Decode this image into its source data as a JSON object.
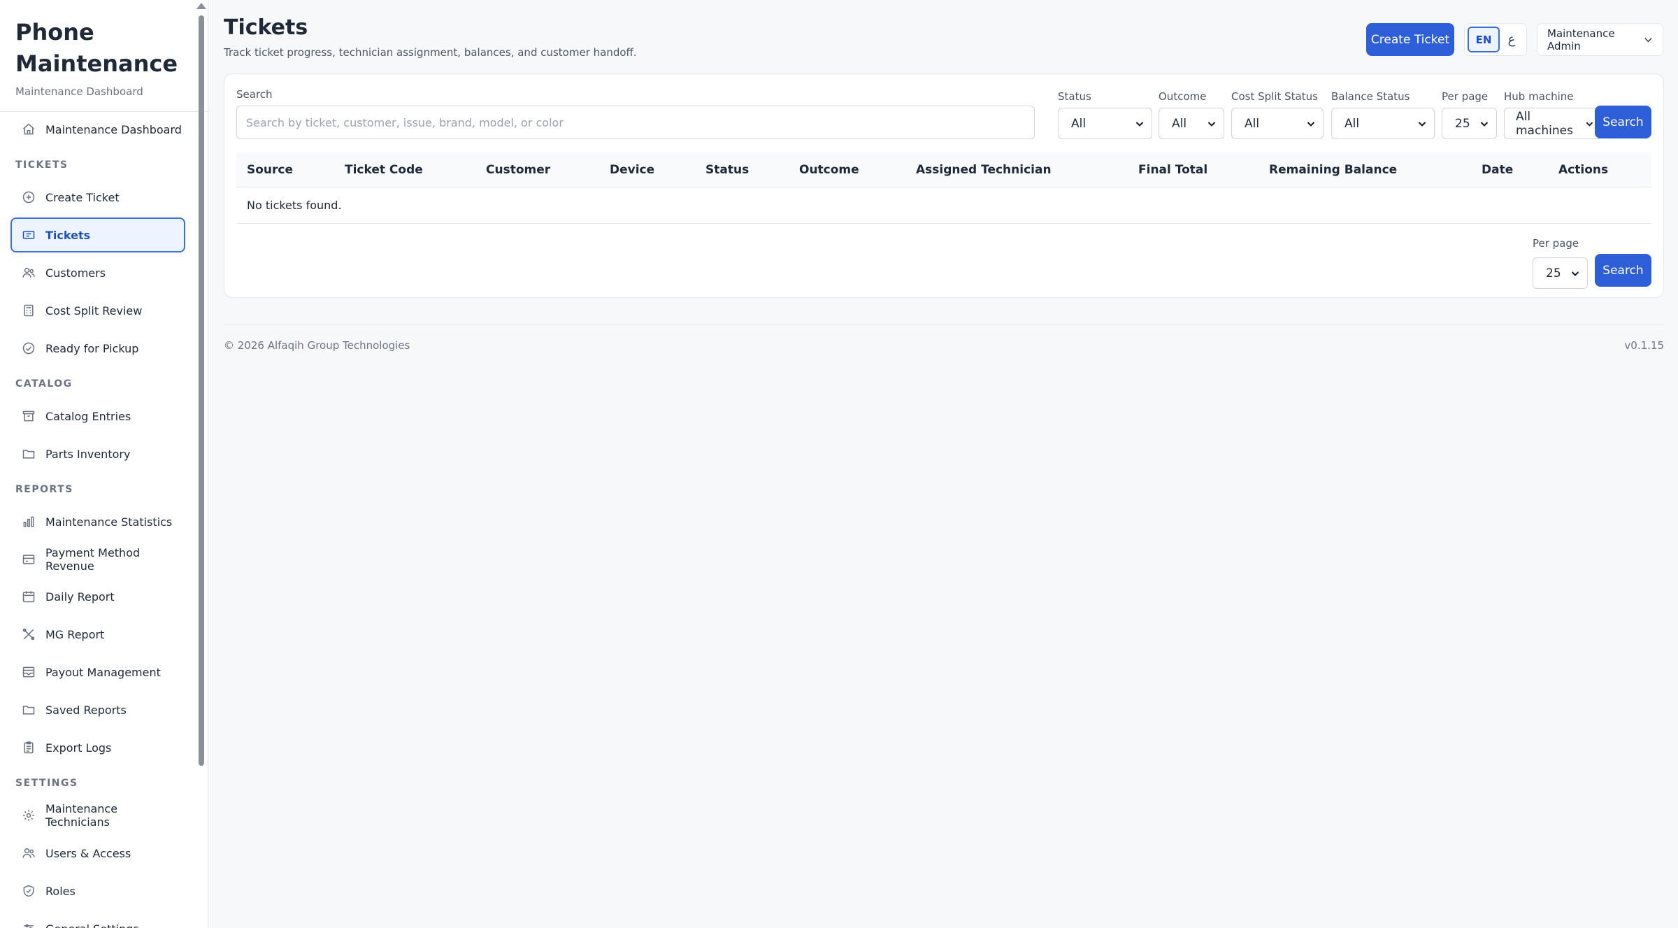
{
  "sidebar": {
    "brand_title": "Phone Maintenance",
    "brand_sub": "Maintenance Dashboard",
    "dashboard": "Maintenance Dashboard",
    "sections": {
      "tickets": "TICKETS",
      "catalog": "CATALOG",
      "reports": "REPORTS",
      "settings": "SETTINGS"
    },
    "items": {
      "create_ticket": "Create Ticket",
      "tickets": "Tickets",
      "customers": "Customers",
      "cost_split_review": "Cost Split Review",
      "ready_for_pickup": "Ready for Pickup",
      "catalog_entries": "Catalog Entries",
      "parts_inventory": "Parts Inventory",
      "maintenance_statistics": "Maintenance Statistics",
      "payment_method_revenue": "Payment Method Revenue",
      "daily_report": "Daily Report",
      "mg_report": "MG Report",
      "payout_management": "Payout Management",
      "saved_reports": "Saved Reports",
      "export_logs": "Export Logs",
      "maintenance_technicians": "Maintenance Technicians",
      "users_access": "Users & Access",
      "roles": "Roles",
      "general_settings": "General Settings"
    }
  },
  "header": {
    "title": "Tickets",
    "subtitle": "Track ticket progress, technician assignment, balances, and customer handoff.",
    "create_button": "Create Ticket",
    "lang_en": "EN",
    "lang_ar": "ع",
    "user_menu": "Maintenance Admin"
  },
  "filters": {
    "search_label": "Search",
    "search_placeholder": "Search by ticket, customer, issue, brand, model, or color",
    "search_value": "",
    "status_label": "Status",
    "status_value": "All",
    "outcome_label": "Outcome",
    "outcome_value": "All",
    "cost_split_label": "Cost Split Status",
    "cost_split_value": "All",
    "balance_label": "Balance Status",
    "balance_value": "All",
    "per_page_label": "Per page",
    "per_page_value": "25",
    "hub_label": "Hub machine",
    "hub_value": "All machines",
    "search_button": "Search"
  },
  "table": {
    "columns": [
      "Source",
      "Ticket Code",
      "Customer",
      "Device",
      "Status",
      "Outcome",
      "Assigned Technician",
      "Final Total",
      "Remaining Balance",
      "Date",
      "Actions"
    ],
    "empty_message": "No tickets found."
  },
  "pagination": {
    "per_page_label": "Per page",
    "per_page_value": "25",
    "search_button": "Search"
  },
  "footer": {
    "copyright": "© 2026 Alfaqih Group Technologies",
    "version": "v0.1.15"
  },
  "colors": {
    "accent": "#2f5fd8",
    "active_bg": "#eef4ff",
    "border": "#e5e7eb"
  }
}
